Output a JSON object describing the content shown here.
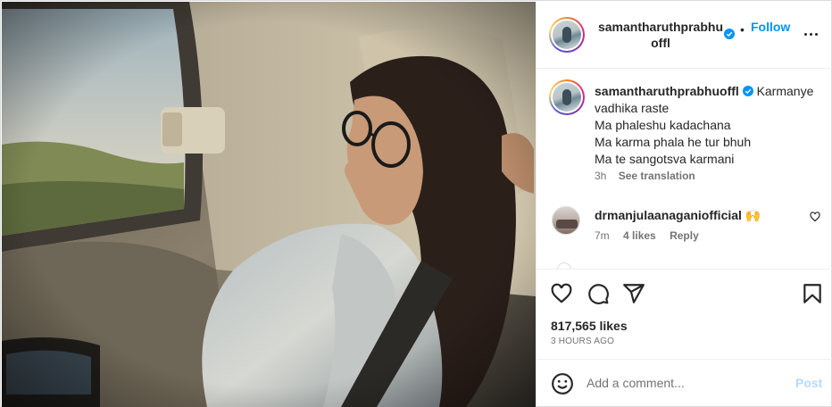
{
  "post": {
    "author": "samantharuthprabhuoffl",
    "header_username": "samantharuthprabhuoffl",
    "follow_label": "Follow",
    "separator": "•",
    "caption_lines": [
      "Karmanye vadhika raste",
      "Ma phaleshu kadachana",
      "Ma karma phala he tur bhuh",
      "Ma te sangotsva karmani"
    ],
    "caption_age": "3h",
    "see_translation_label": "See translation",
    "likes_text": "817,565 likes",
    "timestamp": "3 HOURS AGO"
  },
  "comments": [
    {
      "username": "drmanjulaanaganiofficial",
      "emoji": "🙌",
      "age": "7m",
      "likes": "4 likes",
      "reply_label": "Reply"
    }
  ],
  "add_comment": {
    "placeholder": "Add a comment...",
    "post_label": "Post"
  },
  "icons": {
    "actions": [
      "heart-icon",
      "comment-icon",
      "share-icon",
      "bookmark-icon"
    ],
    "more": "more-options-icon",
    "verified": "verified-badge-icon",
    "emoji": "emoji-icon"
  },
  "colors": {
    "accent": "#0095f6",
    "verified": "#0095f6",
    "post_disabled": "#b3dbff",
    "text": "#262626",
    "muted": "#737373",
    "divider": "#efefef"
  }
}
